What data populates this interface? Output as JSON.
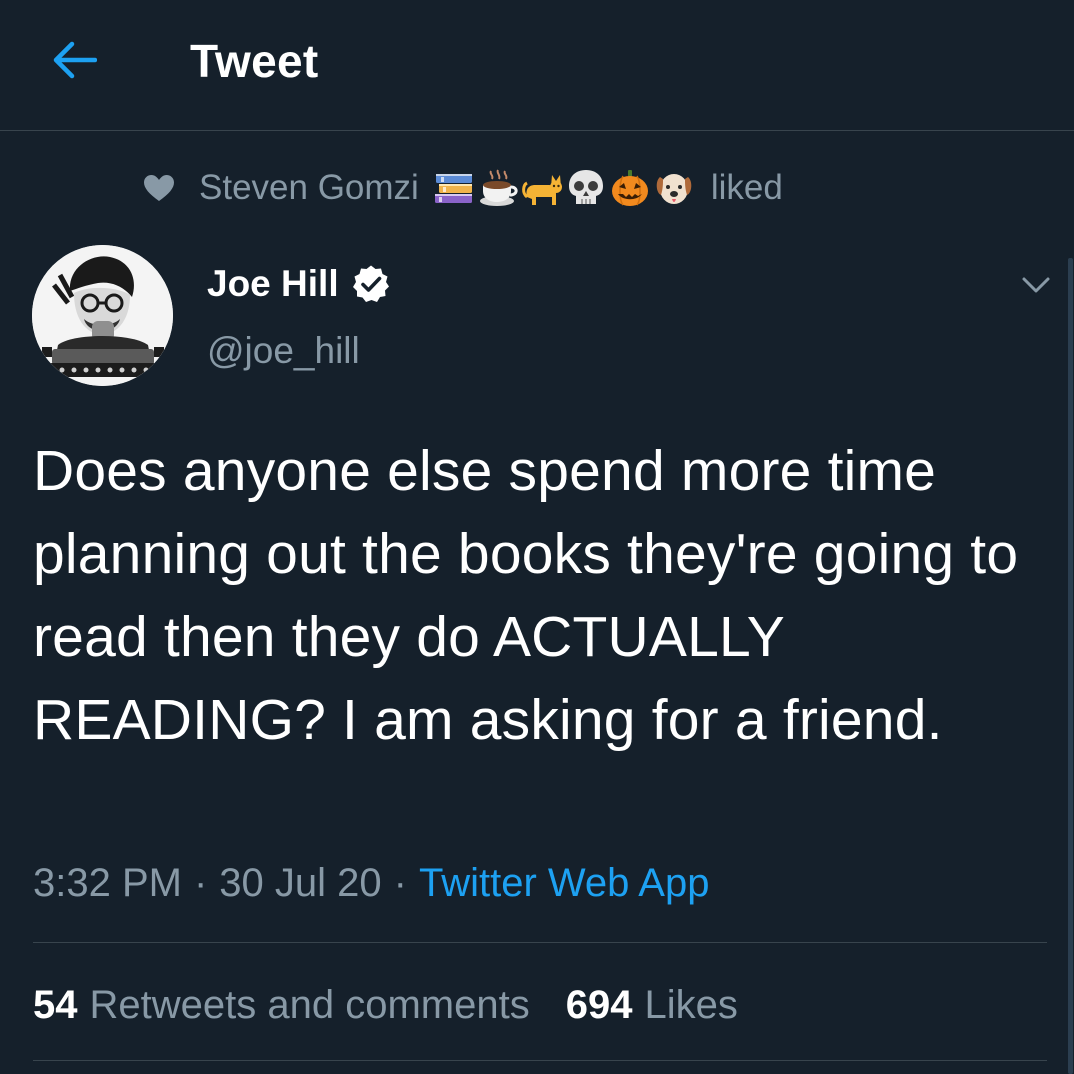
{
  "header": {
    "title": "Tweet",
    "back_icon": "arrow-left-icon",
    "accent_color": "#1da1f2"
  },
  "social_context": {
    "icon": "heart-icon",
    "name": "Steven Gomzi",
    "emojis": [
      "books-emoji",
      "coffee-emoji",
      "cat-emoji",
      "skull-emoji",
      "jack-o-lantern-emoji",
      "dog-face-emoji"
    ],
    "verb": "liked"
  },
  "author": {
    "name": "Joe Hill",
    "handle": "@joe_hill",
    "verified": true
  },
  "tweet": {
    "text": "Does anyone else spend more time planning out the books they're going to read then they do ACTUALLY READING? I am asking for a friend.",
    "time": "3:32 PM",
    "date": "30 Jul 20",
    "separator": "·",
    "source": "Twitter Web App"
  },
  "stats": {
    "retweets_count": "54",
    "retweets_label": "Retweets and comments",
    "likes_count": "694",
    "likes_label": "Likes"
  },
  "colors": {
    "background": "#15202b",
    "secondary_text": "#8899a6",
    "divider": "#38444d",
    "link": "#1da1f2"
  }
}
